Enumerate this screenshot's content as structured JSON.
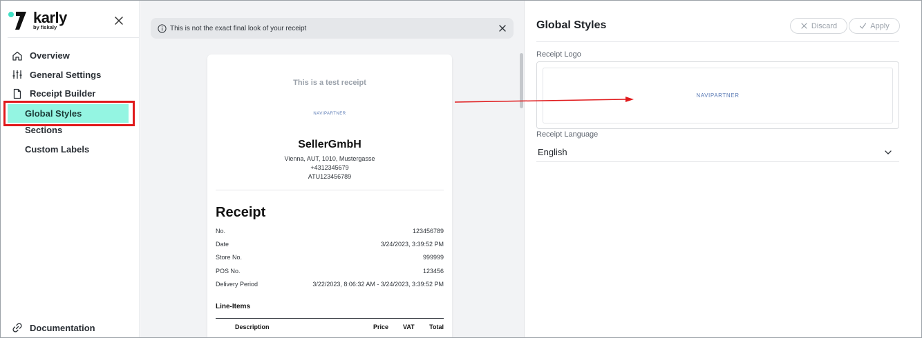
{
  "sidebar": {
    "brand": {
      "name": "karly",
      "sub": "by fiskaly",
      "accent": "#3fe0c5"
    },
    "items": [
      {
        "label": "Overview",
        "icon": "home-icon"
      },
      {
        "label": "General Settings",
        "icon": "sliders-icon"
      },
      {
        "label": "Receipt Builder",
        "icon": "document-icon"
      }
    ],
    "sub_items": [
      {
        "label": "Global Styles",
        "active": true
      },
      {
        "label": "Sections"
      },
      {
        "label": "Custom Labels"
      }
    ],
    "documentation": {
      "label": "Documentation",
      "icon": "link-icon"
    },
    "highlight_color": "#e0191b",
    "active_bg": "#94f5e2"
  },
  "preview": {
    "notice": "This is not the exact final look of your receipt",
    "receipt": {
      "test_label": "This is a test receipt",
      "logo_text": "NAVIPARTNER",
      "seller": "SellerGmbH",
      "address": "Vienna, AUT, 1010, Mustergasse",
      "phone": "+4312345679",
      "vat_id": "ATU123456789",
      "title": "Receipt",
      "rows": [
        {
          "label": "No.",
          "value": "123456789"
        },
        {
          "label": "Date",
          "value": "3/24/2023, 3:39:52 PM"
        },
        {
          "label": "Store No.",
          "value": "999999"
        },
        {
          "label": "POS No.",
          "value": "123456"
        },
        {
          "label": "Delivery Period",
          "value": "3/22/2023, 8:06:32 AM - 3/24/2023, 3:39:52 PM"
        }
      ],
      "line_items_title": "Line-Items",
      "columns": {
        "description": "Description",
        "price": "Price",
        "vat": "VAT",
        "total": "Total"
      }
    }
  },
  "panel": {
    "title": "Global Styles",
    "discard": "Discard",
    "apply": "Apply",
    "logo_label": "Receipt Logo",
    "logo_text": "NAVIPARTNER",
    "language_label": "Receipt Language",
    "language_value": "English"
  }
}
